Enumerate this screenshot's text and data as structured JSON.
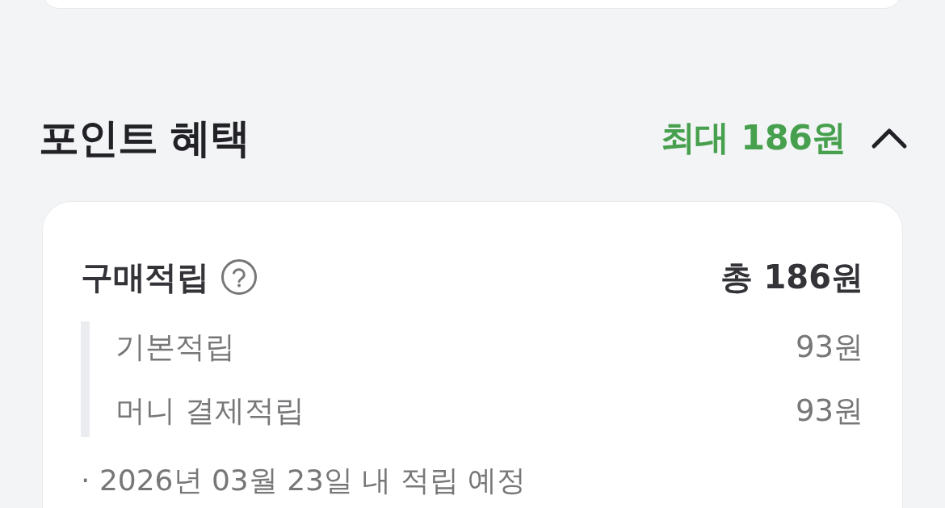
{
  "section": {
    "title": "포인트 혜택",
    "summary": "최대 186원",
    "expanded": true
  },
  "purchase_points": {
    "title": "구매적립",
    "total": "총 186원",
    "items": [
      {
        "label": "기본적립",
        "value": "93원"
      },
      {
        "label": "머니 결제적립",
        "value": "93원"
      }
    ],
    "note": "· 2026년 03월 23일 내 적립 예정"
  }
}
